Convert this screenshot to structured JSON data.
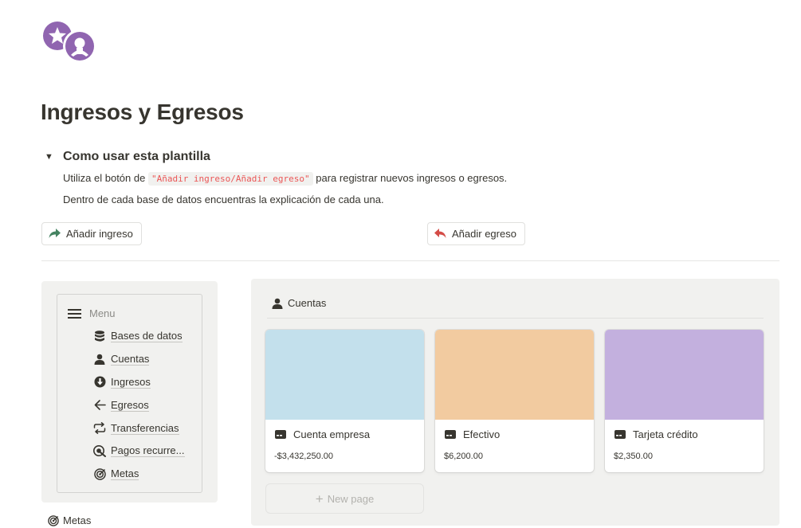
{
  "page": {
    "title": "Ingresos y Egresos",
    "icon": "stars-avatar-icon",
    "icon_color": "#9065b0"
  },
  "toggle": {
    "title": "Como usar esta plantilla",
    "line1_before": "Utiliza el botón de ",
    "line1_code": "\"Añadir ingreso/Añadir egreso\"",
    "line1_after": " para registrar nuevos ingresos o egresos.",
    "line2": "Dentro de cada base de datos encuentras la explicación de cada una."
  },
  "buttons": {
    "add_income": "Añadir ingreso",
    "add_income_color": "#448361",
    "add_expense": "Añadir egreso",
    "add_expense_color": "#d44c47"
  },
  "menu": {
    "header": "Menu",
    "items": [
      {
        "label": "Bases de datos",
        "icon": "database-icon"
      },
      {
        "label": "Cuentas",
        "icon": "user-icon"
      },
      {
        "label": "Ingresos",
        "icon": "arrow-down-circle-icon"
      },
      {
        "label": "Egresos",
        "icon": "arrow-left-icon"
      },
      {
        "label": "Transferencias",
        "icon": "repeat-icon"
      },
      {
        "label": "Pagos recurre...",
        "icon": "target-arrow-icon"
      },
      {
        "label": "Metas",
        "icon": "target-icon"
      }
    ]
  },
  "metas_heading": "Metas",
  "gallery": {
    "title": "Cuentas",
    "cards": [
      {
        "title": "Cuenta empresa",
        "value": "-$3,432,250.00",
        "cover": "#c3e0ec"
      },
      {
        "title": "Efectivo",
        "value": "$6,200.00",
        "cover": "#f2cba0"
      },
      {
        "title": "Tarjeta crédito",
        "value": "$2,350.00",
        "cover": "#c3b0de"
      }
    ],
    "new_page": "New page"
  }
}
